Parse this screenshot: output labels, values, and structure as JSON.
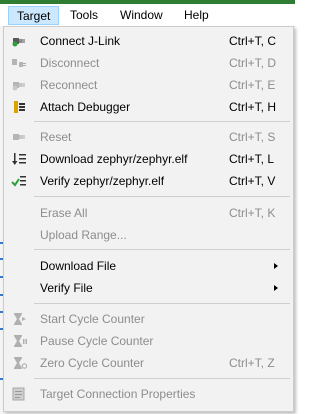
{
  "menubar": {
    "items": [
      "Target",
      "Tools",
      "Window",
      "Help"
    ]
  },
  "menu": {
    "connect": {
      "label": "Connect J-Link",
      "shortcut": "Ctrl+T, C",
      "icon": "connect-plug-icon"
    },
    "disconnect": {
      "label": "Disconnect",
      "shortcut": "Ctrl+T, D",
      "icon": "disconnect-plug-icon"
    },
    "reconnect": {
      "label": "Reconnect",
      "shortcut": "Ctrl+T, E",
      "icon": "reconnect-plug-icon"
    },
    "attach": {
      "label": "Attach Debugger",
      "shortcut": "Ctrl+T, H",
      "icon": "attach-debugger-icon"
    },
    "reset": {
      "label": "Reset",
      "shortcut": "Ctrl+T, S",
      "icon": "reset-icon"
    },
    "download": {
      "label": "Download zephyr/zephyr.elf",
      "shortcut": "Ctrl+T, L",
      "icon": "download-icon"
    },
    "verify": {
      "label": "Verify zephyr/zephyr.elf",
      "shortcut": "Ctrl+T, V",
      "icon": "verify-check-icon"
    },
    "erase_all": {
      "label": "Erase All",
      "shortcut": "Ctrl+T, K"
    },
    "upload_range": {
      "label": "Upload Range..."
    },
    "download_file": {
      "label": "Download File"
    },
    "verify_file": {
      "label": "Verify File"
    },
    "start_cycle": {
      "label": "Start Cycle Counter",
      "icon": "hourglass-start-icon"
    },
    "pause_cycle": {
      "label": "Pause Cycle Counter",
      "icon": "hourglass-pause-icon"
    },
    "zero_cycle": {
      "label": "Zero Cycle Counter",
      "shortcut": "Ctrl+T, Z",
      "icon": "hourglass-zero-icon"
    },
    "properties": {
      "label": "Target Connection Properties",
      "icon": "properties-icon"
    }
  },
  "colors": {
    "menu_bg": "#f2f2f2",
    "active_menu_bg": "#cce8ff",
    "disabled_text": "#8d8d8d",
    "separator": "#cfcfcf"
  }
}
